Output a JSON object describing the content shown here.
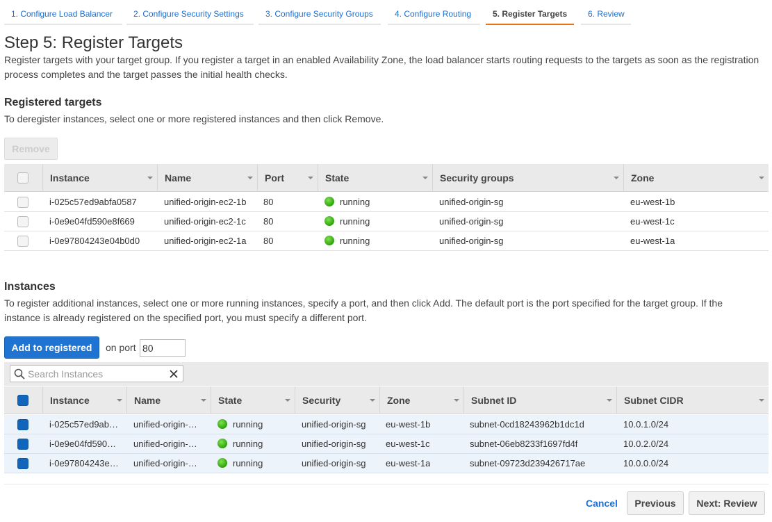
{
  "wizard": {
    "tabs": [
      {
        "label": "1. Configure Load Balancer"
      },
      {
        "label": "2. Configure Security Settings"
      },
      {
        "label": "3. Configure Security Groups"
      },
      {
        "label": "4. Configure Routing"
      },
      {
        "label": "5. Register Targets"
      },
      {
        "label": "6. Review"
      }
    ],
    "active_tab": "5. Register Targets"
  },
  "page": {
    "title": "Step 5: Register Targets",
    "description": "Register targets with your target group. If you register a target in an enabled Availability Zone, the load balancer starts routing requests to the targets as soon as the registration process completes and the target passes the initial health checks."
  },
  "registered": {
    "title": "Registered targets",
    "description": "To deregister instances, select one or more registered instances and then click Remove.",
    "remove_label": "Remove",
    "columns": [
      "Instance",
      "Name",
      "Port",
      "State",
      "Security groups",
      "Zone"
    ],
    "rows": [
      {
        "instance": "i-025c57ed9abfa0587",
        "name": "unified-origin-ec2-1b",
        "port": "80",
        "state": "running",
        "security": "unified-origin-sg",
        "zone": "eu-west-1b"
      },
      {
        "instance": "i-0e9e04fd590e8f669",
        "name": "unified-origin-ec2-1c",
        "port": "80",
        "state": "running",
        "security": "unified-origin-sg",
        "zone": "eu-west-1c"
      },
      {
        "instance": "i-0e97804243e04b0d0",
        "name": "unified-origin-ec2-1a",
        "port": "80",
        "state": "running",
        "security": "unified-origin-sg",
        "zone": "eu-west-1a"
      }
    ]
  },
  "instances": {
    "title": "Instances",
    "description": "To register additional instances, select one or more running instances, specify a port, and then click Add. The default port is the port specified for the target group. If the instance is already registered on the specified port, you must specify a different port.",
    "add_label": "Add to registered",
    "port_label": "on port",
    "port_value": "80",
    "search_placeholder": "Search Instances",
    "columns": [
      "Instance",
      "Name",
      "State",
      "Security",
      "Zone",
      "Subnet ID",
      "Subnet CIDR"
    ],
    "rows": [
      {
        "instance": "i-025c57ed9ab…",
        "name": "unified-origin-…",
        "state": "running",
        "security": "unified-origin-sg",
        "zone": "eu-west-1b",
        "subnet": "subnet-0cd18243962b1dc1d",
        "cidr": "10.0.1.0/24",
        "checked": true
      },
      {
        "instance": "i-0e9e04fd590…",
        "name": "unified-origin-…",
        "state": "running",
        "security": "unified-origin-sg",
        "zone": "eu-west-1c",
        "subnet": "subnet-06eb8233f1697fd4f",
        "cidr": "10.0.2.0/24",
        "checked": true
      },
      {
        "instance": "i-0e97804243e…",
        "name": "unified-origin-…",
        "state": "running",
        "security": "unified-origin-sg",
        "zone": "eu-west-1a",
        "subnet": "subnet-09723d239426717ae",
        "cidr": "10.0.0.0/24",
        "checked": true
      }
    ]
  },
  "footer": {
    "cancel_label": "Cancel",
    "previous_label": "Previous",
    "next_label": "Next: Review"
  },
  "colors": {
    "accent": "#1f74d2",
    "link": "#1c6fd1",
    "active_tab_underline": "#ec7211",
    "running": "#2ea20a"
  }
}
